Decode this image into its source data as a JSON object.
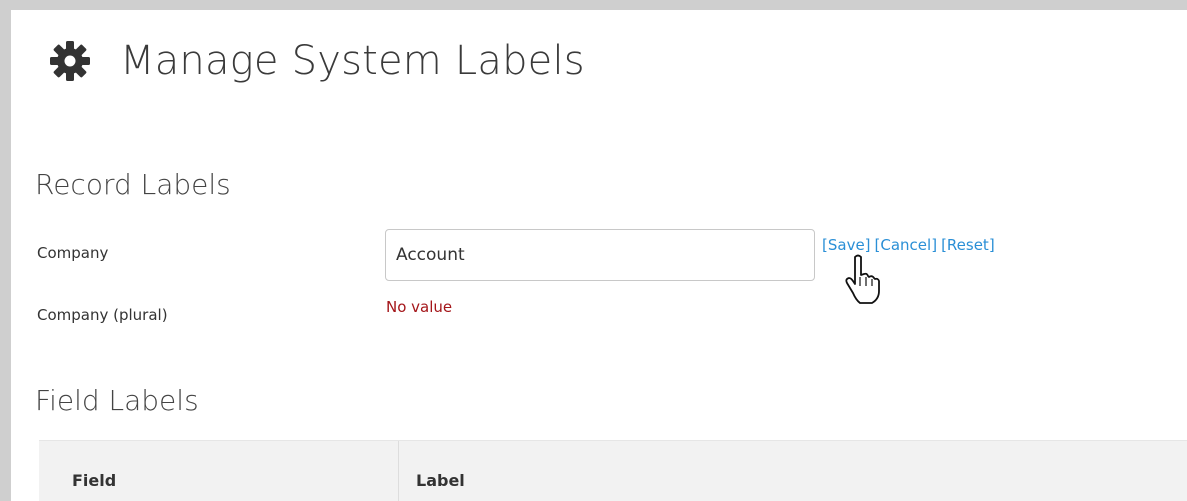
{
  "page": {
    "title": "Manage System Labels",
    "icon": "gear-icon"
  },
  "record_labels": {
    "section_title": "Record Labels",
    "rows": [
      {
        "label": "Company",
        "input_value": "Account",
        "actions": [
          "[Save]",
          "[Cancel]",
          "[Reset]"
        ]
      },
      {
        "label": "Company (plural)",
        "value": "No value"
      }
    ]
  },
  "field_labels": {
    "section_title": "Field Labels",
    "columns": [
      "Field",
      "Label"
    ]
  },
  "colors": {
    "link": "#2a8fd6",
    "no_value": "#a4161a",
    "table_header_bg": "#f2f2f2"
  }
}
